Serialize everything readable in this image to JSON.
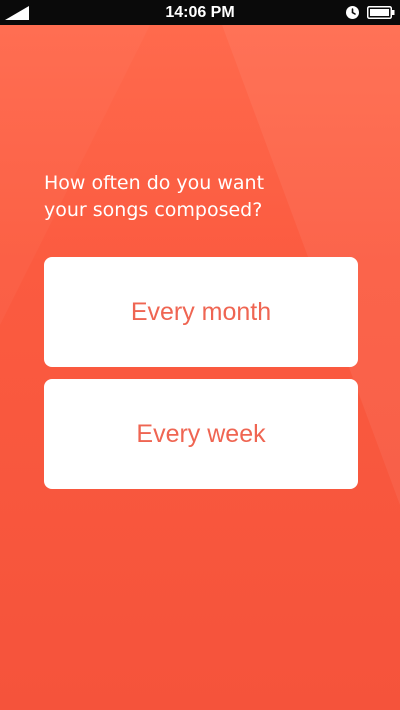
{
  "status_bar": {
    "time": "14:06 PM",
    "icons": [
      "signal-icon",
      "alarm-icon",
      "battery-icon"
    ]
  },
  "question": {
    "text": "How often do you want\nyour songs composed?"
  },
  "options": [
    {
      "label": "Every month"
    },
    {
      "label": "Every week"
    }
  ],
  "colors": {
    "background": "#f7553c",
    "option_text": "#ef6552",
    "option_background": "#ffffff",
    "question_text": "#ffffff",
    "status_bar": "#0a0a0a"
  }
}
